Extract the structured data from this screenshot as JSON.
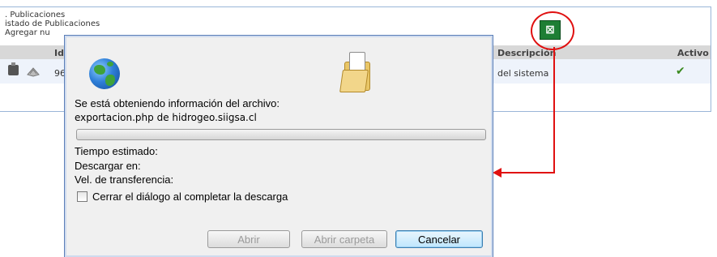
{
  "background_page": {
    "breadcrumb_1": ". Publicaciones",
    "breadcrumb_2": "istado de Publicaciones",
    "breadcrumb_3": "Agregar nu",
    "columns": {
      "id": "Id",
      "descripcion": "Descripción",
      "activo": "Activo"
    },
    "row": {
      "id": "96",
      "descripcion": "del sistema",
      "activo_icon": "checkmark-icon"
    },
    "excel_icon": "excel-export-icon",
    "annotation_color": "#e01010"
  },
  "dialog": {
    "info_label": "Se está obteniendo información del archivo:",
    "file_name": "exportacion.php de hidrogeo.siigsa.cl",
    "tiempo_label": "Tiempo estimado:",
    "descargar_label": "Descargar en:",
    "vel_label": "Vel. de transferencia:",
    "close_checkbox_label": "Cerrar el diálogo al completar la descarga",
    "buttons": {
      "open": "Abrir",
      "open_folder": "Abrir carpeta",
      "cancel": "Cancelar"
    },
    "progress": 0
  }
}
